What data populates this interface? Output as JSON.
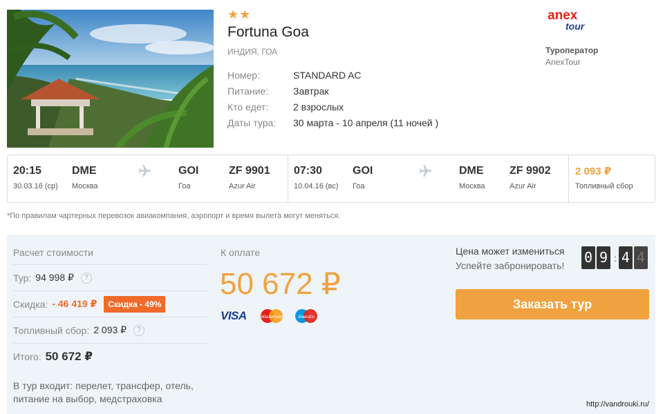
{
  "hotel": {
    "stars": "★★",
    "name": "Fortuna Goa",
    "location": "ИНДИЯ, ГОА",
    "details": [
      {
        "label": "Номер:",
        "value": "STANDARD AC"
      },
      {
        "label": "Питание:",
        "value": "Завтрак"
      },
      {
        "label": "Кто едет:",
        "value": "2 взрослых"
      },
      {
        "label": "Даты тура:",
        "value": "30 марта - 10 апреля (11 ночей )"
      }
    ]
  },
  "operator": {
    "logo_top": "anex",
    "logo_bottom": "tour",
    "title": "Туроператор",
    "name": "AnexTour"
  },
  "flight_out": {
    "time": "20:15",
    "date": "30.03.16 (ср)",
    "from_code": "DME",
    "from_city": "Москва",
    "to_code": "GOI",
    "to_city": "Гоа",
    "flight_no": "ZF 9901",
    "airline": "Azur Air",
    "icon": "plane-icon"
  },
  "flight_back": {
    "time": "07:30",
    "date": "10.04.16 (вс)",
    "from_code": "GOI",
    "from_city": "Гоа",
    "to_code": "DME",
    "to_city": "Москва",
    "flight_no": "ZF 9902",
    "airline": "Azur Air",
    "icon": "plane-icon"
  },
  "fuel_fee": {
    "amount": "2 093 ₽",
    "label": "Топливный сбор"
  },
  "note": "*По правилам чартерных перевозок авиакомпания, аэропорт и время вылета могут меняться.",
  "calc": {
    "title": "Расчет стоимости",
    "tour_label": "Тур:",
    "tour_value": "94 998 ₽",
    "discount_label": "Скидка:",
    "discount_value": "- 46 419 ₽",
    "discount_badge": "Скидка - 49%",
    "fuel_label": "Топливный сбор:",
    "fuel_value": "2 093 ₽",
    "total_label": "Итого:",
    "total_value": "50 672 ₽",
    "help_icon": "?",
    "includes": "В тур входит: перелет, трансфер, отель, питание на выбор, медстраховка"
  },
  "payment": {
    "label": "К оплате",
    "amount": "50 672 ₽",
    "cards": [
      "VISA",
      "MasterCard",
      "Maestro"
    ]
  },
  "booking": {
    "price_change": "Цена может измениться",
    "hurry": "Успейте забронировать!",
    "timer": [
      "0",
      "9",
      "4",
      "4"
    ],
    "button": "Заказать тур"
  },
  "colors": {
    "accent": "#f0a240",
    "discount": "#f06a2a",
    "panel_bg": "#eff4f8"
  },
  "watermark": "http://vandrouki.ru/"
}
